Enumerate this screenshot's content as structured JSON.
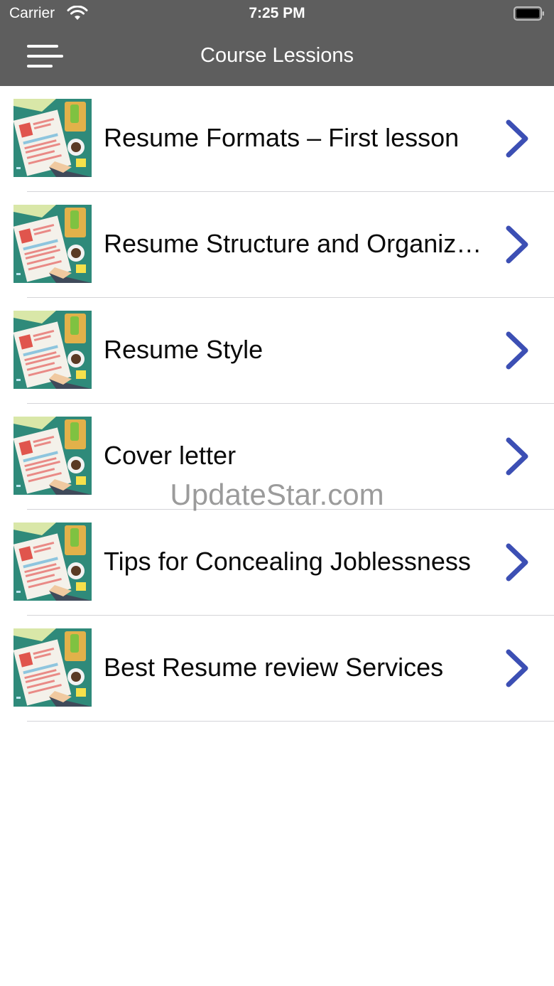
{
  "status_bar": {
    "carrier": "Carrier",
    "time": "7:25 PM"
  },
  "nav_bar": {
    "title": "Course Lessions",
    "menu_icon": "hamburger-menu-icon",
    "background": "#5e5e5e"
  },
  "lessons": [
    {
      "label": "Resume Formats – First lesson"
    },
    {
      "label": "Resume Structure and Organization"
    },
    {
      "label": "Resume Style"
    },
    {
      "label": "Cover letter"
    },
    {
      "label": "Tips for Concealing Joblessness"
    },
    {
      "label": "Best Resume review Services"
    }
  ],
  "row_icons": {
    "thumbnail": "resume-document-thumbnail",
    "disclosure": "chevron-right-icon",
    "chevron_color": "#3c4fb4"
  },
  "watermark": "UpdateStar.com"
}
